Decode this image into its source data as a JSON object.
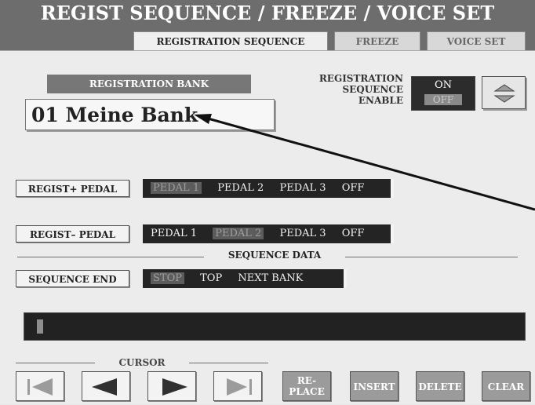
{
  "title": "REGIST SEQUENCE / FREEZE / VOICE SET",
  "tabs": [
    {
      "label": "REGISTRATION SEQUENCE",
      "active": true
    },
    {
      "label": "FREEZE",
      "active": false
    },
    {
      "label": "VOICE SET",
      "active": false
    }
  ],
  "registration_bank": {
    "label": "REGISTRATION BANK",
    "value": "01 Meine Bank"
  },
  "sequence_enable": {
    "label_line1": "REGISTRATION",
    "label_line2": "SEQUENCE",
    "label_line3": "ENABLE",
    "on_label": "ON",
    "off_label": "OFF",
    "selected": "OFF"
  },
  "regist_plus_pedal": {
    "label": "REGIST+ PEDAL",
    "options": [
      "PEDAL 1",
      "PEDAL 2",
      "PEDAL 3",
      "OFF"
    ],
    "selected": "PEDAL 1"
  },
  "regist_minus_pedal": {
    "label": "REGIST– PEDAL",
    "options": [
      "PEDAL 1",
      "PEDAL 2",
      "PEDAL 3",
      "OFF"
    ],
    "selected": "PEDAL 2"
  },
  "sequence_data": {
    "label": "SEQUENCE DATA"
  },
  "sequence_end": {
    "label": "SEQUENCE END",
    "options": [
      "STOP",
      "TOP",
      "NEXT BANK"
    ],
    "selected": "STOP"
  },
  "cursor": {
    "label": "CURSOR"
  },
  "controls": {
    "replace_line1": "RE-",
    "replace_line2": "PLACE",
    "insert": "INSERT",
    "delete": "DELETE",
    "clear": "CLEAR"
  },
  "colors": {
    "title_bg": "#6d6d6d",
    "panel_bg": "#ececec",
    "dark_bar": "#242424",
    "gray_button": "#9b9b9b"
  }
}
